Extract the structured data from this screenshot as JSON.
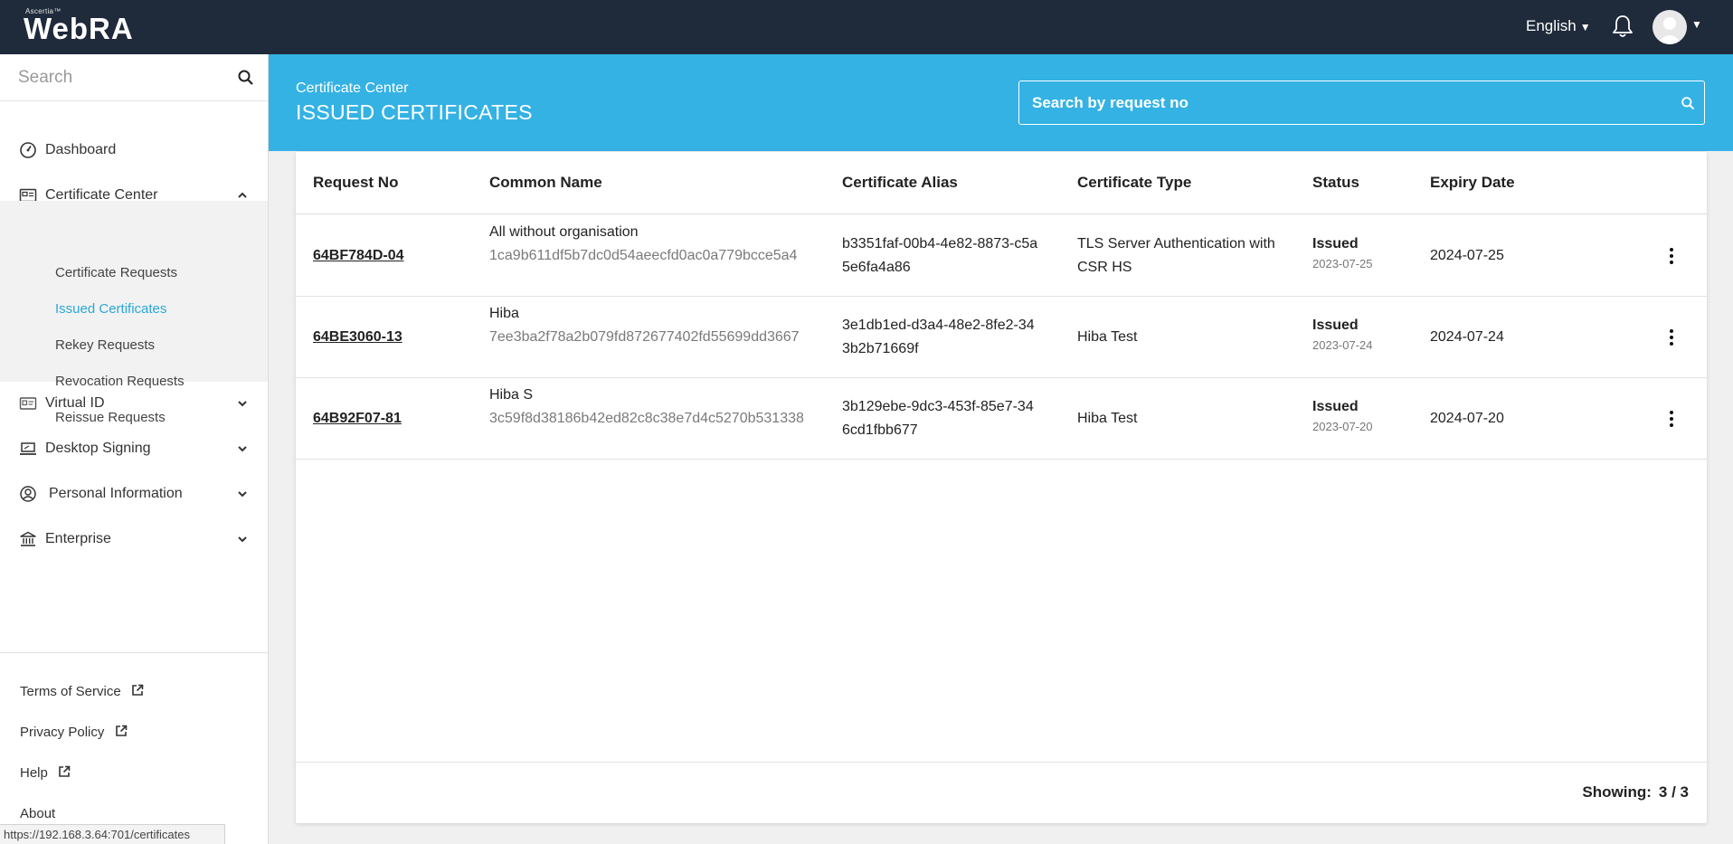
{
  "header": {
    "brand_small": "Ascertia™",
    "brand_name": "WebRA",
    "language": "English"
  },
  "sidebar": {
    "search_placeholder": "Search",
    "items": [
      {
        "label": "Dashboard",
        "icon": "dashboard-icon"
      },
      {
        "label": "Certificate Center",
        "icon": "certificate-icon",
        "expanded": true
      },
      {
        "label": "Virtual ID",
        "icon": "id-card-icon"
      },
      {
        "label": "Desktop Signing",
        "icon": "desktop-icon"
      },
      {
        "label": "Personal Information",
        "icon": "user-circle-icon"
      },
      {
        "label": "Enterprise",
        "icon": "bank-icon"
      }
    ],
    "sub_items": [
      {
        "label": "Certificate Requests"
      },
      {
        "label": "Issued Certificates",
        "active": true
      },
      {
        "label": "Rekey Requests"
      },
      {
        "label": "Revocation Requests"
      },
      {
        "label": "Reissue Requests"
      }
    ],
    "footer": [
      "Terms of Service",
      "Privacy Policy",
      "Help",
      "About"
    ]
  },
  "status_url": "https://192.168.3.64:701/certificates",
  "main": {
    "breadcrumb": "Certificate Center",
    "title": "ISSUED CERTIFICATES",
    "search_placeholder": "Search by request no",
    "columns": [
      "Request No",
      "Common Name",
      "Certificate Alias",
      "Certificate Type",
      "Status",
      "Expiry Date"
    ],
    "rows": [
      {
        "request_no": "64BF784D-04",
        "cn_name": "All without organisation",
        "cn_hash": "1ca9b611df5b7dc0d54aeecfd0ac0a779bcce5a4",
        "alias": "b3351faf-00b4-4e82-8873-c5a5e6fa4a86",
        "type": "TLS Server Authentication with CSR HS",
        "status": "Issued",
        "status_date": "2023-07-25",
        "expiry": "2024-07-25"
      },
      {
        "request_no": "64BE3060-13",
        "cn_name": "Hiba",
        "cn_hash": "7ee3ba2f78a2b079fd872677402fd55699dd3667",
        "alias": "3e1db1ed-d3a4-48e2-8fe2-343b2b71669f",
        "type": "Hiba Test",
        "status": "Issued",
        "status_date": "2023-07-24",
        "expiry": "2024-07-24"
      },
      {
        "request_no": "64B92F07-81",
        "cn_name": "Hiba S",
        "cn_hash": "3c59f8d38186b42ed82c8c38e7d4c5270b531338",
        "alias": "3b129ebe-9dc3-453f-85e7-346cd1fbb677",
        "type": "Hiba Test",
        "status": "Issued",
        "status_date": "2023-07-20",
        "expiry": "2024-07-20"
      }
    ],
    "showing_label": "Showing:",
    "showing_value": "3 / 3"
  },
  "colors": {
    "topbar": "#1f2a3b",
    "banner": "#34b2e4",
    "active_link": "#2aa7d9"
  }
}
